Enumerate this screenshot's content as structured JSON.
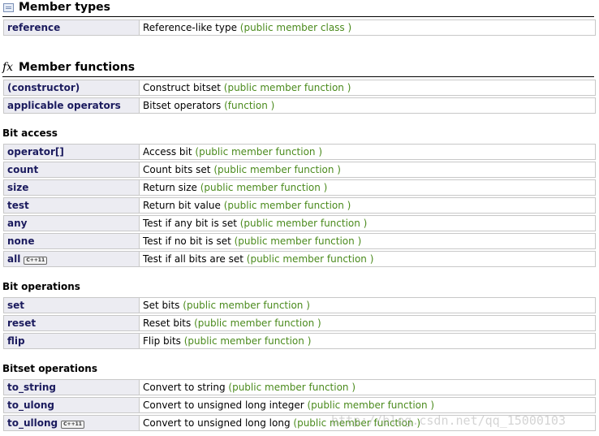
{
  "sections": {
    "member_types": {
      "title": "Member types"
    },
    "member_functions": {
      "title": "Member functions",
      "glyph": "fx"
    }
  },
  "subheads": {
    "bit_access": "Bit access",
    "bit_operations": "Bit operations",
    "bitset_operations": "Bitset operations"
  },
  "rows": [
    {
      "name": "reference",
      "desc": "Reference-like type",
      "kind": "(public member class )"
    },
    {
      "name": "(constructor)",
      "desc": "Construct bitset",
      "kind": "(public member function )"
    },
    {
      "name": "applicable operators",
      "desc": "Bitset operators",
      "kind": "(function )"
    },
    {
      "name": "operator[]",
      "desc": "Access bit",
      "kind": "(public member function )"
    },
    {
      "name": "count",
      "desc": "Count bits set",
      "kind": "(public member function )"
    },
    {
      "name": "size",
      "desc": "Return size",
      "kind": "(public member function )"
    },
    {
      "name": "test",
      "desc": "Return bit value",
      "kind": "(public member function )"
    },
    {
      "name": "any",
      "desc": "Test if any bit is set",
      "kind": "(public member function )"
    },
    {
      "name": "none",
      "desc": "Test if no bit is set",
      "kind": "(public member function )"
    },
    {
      "name": "all",
      "badge": "C++11",
      "desc": "Test if all bits are set",
      "kind": "(public member function )"
    },
    {
      "name": "set",
      "desc": "Set bits",
      "kind": "(public member function )"
    },
    {
      "name": "reset",
      "desc": "Reset bits",
      "kind": "(public member function )"
    },
    {
      "name": "flip",
      "desc": "Flip bits",
      "kind": "(public member function )"
    },
    {
      "name": "to_string",
      "desc": "Convert to string",
      "kind": "(public member function )"
    },
    {
      "name": "to_ulong",
      "desc": "Convert to unsigned long integer",
      "kind": "(public member function )"
    },
    {
      "name": "to_ullong",
      "badge": "C++11",
      "desc": "Convert to unsigned long long",
      "kind": "(public member function )"
    }
  ],
  "watermark": "http://blog.csdn.net/qq_15000103",
  "colors": {
    "name_text": "#1b1b5e",
    "kind_text": "#4a8a1c",
    "name_cell_bg": "#ececf2"
  }
}
